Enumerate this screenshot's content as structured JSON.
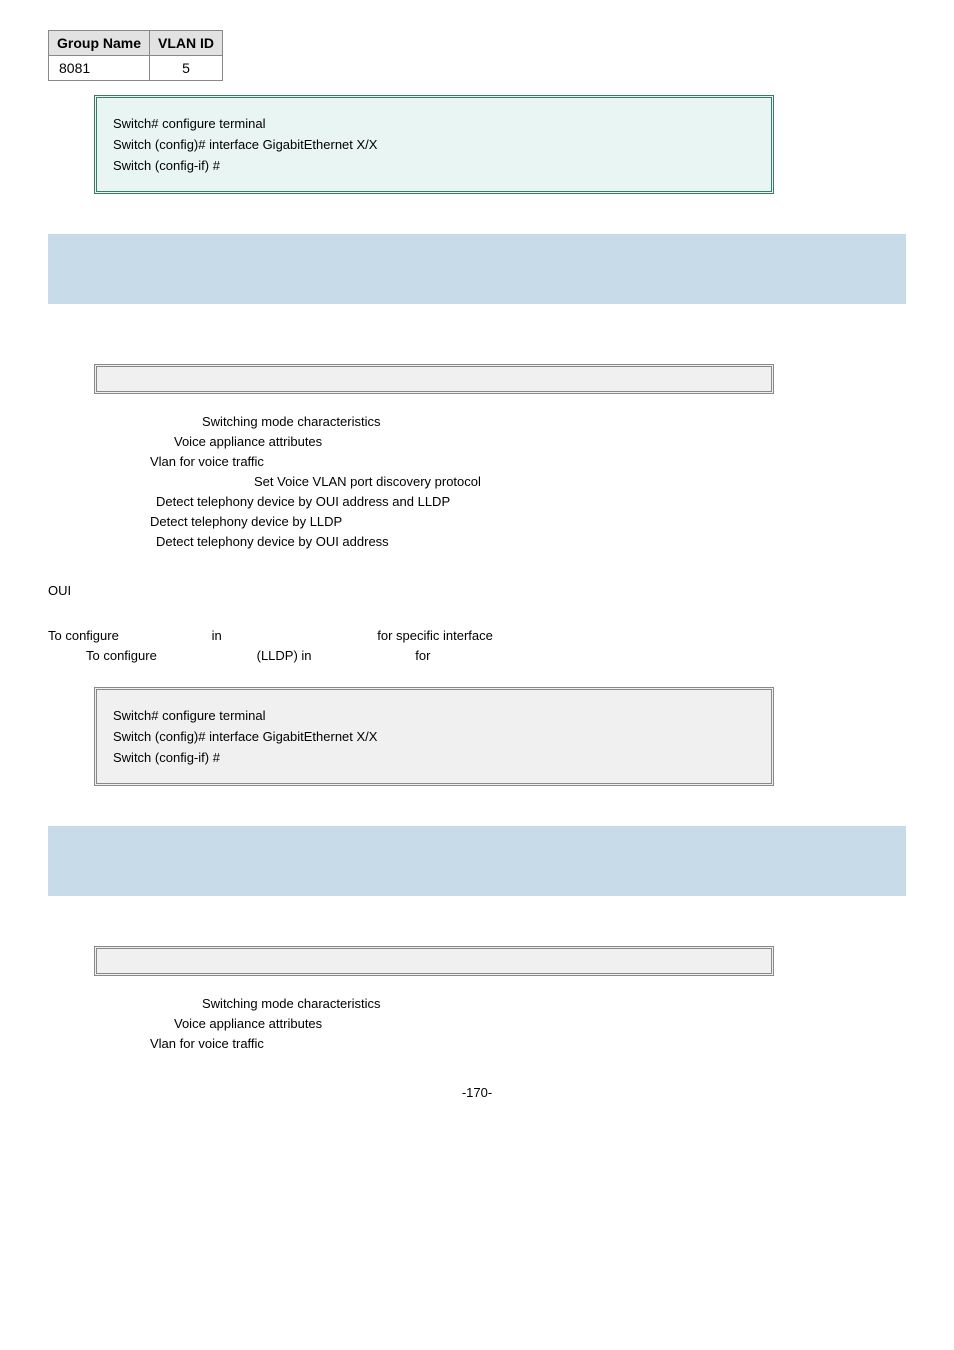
{
  "table": {
    "header_group": "Group Name",
    "header_vlan": "VLAN ID",
    "row_group": "8081",
    "row_vlan": "5"
  },
  "cli1": {
    "l1": "Switch# configure terminal",
    "l2": "Switch (config)# interface GigabitEthernet X/X",
    "l3": "Switch (config-if) #"
  },
  "desc1": {
    "l1": "Switching mode characteristics",
    "l2": "Voice appliance attributes",
    "l3": "Vlan for voice traffic",
    "l4": "Set Voice VLAN port discovery protocol",
    "l5": "Detect telephony device by OUI address and LLDP",
    "l6": "Detect telephony device by LLDP",
    "l7": "Detect telephony device by OUI address"
  },
  "oui": "OUI",
  "usage": {
    "l1a": "To configure",
    "l1b": "in",
    "l1c": "for specific interface",
    "l2a": "To configure",
    "l2b": "(LLDP) in",
    "l2c": "for"
  },
  "cli2": {
    "l1": "Switch# configure terminal",
    "l2": "Switch (config)# interface GigabitEthernet X/X",
    "l3": "Switch (config-if) #"
  },
  "desc2": {
    "l1": "Switching mode characteristics",
    "l2": "Voice appliance attributes",
    "l3": "Vlan for voice traffic"
  },
  "pagenum": "-170-"
}
